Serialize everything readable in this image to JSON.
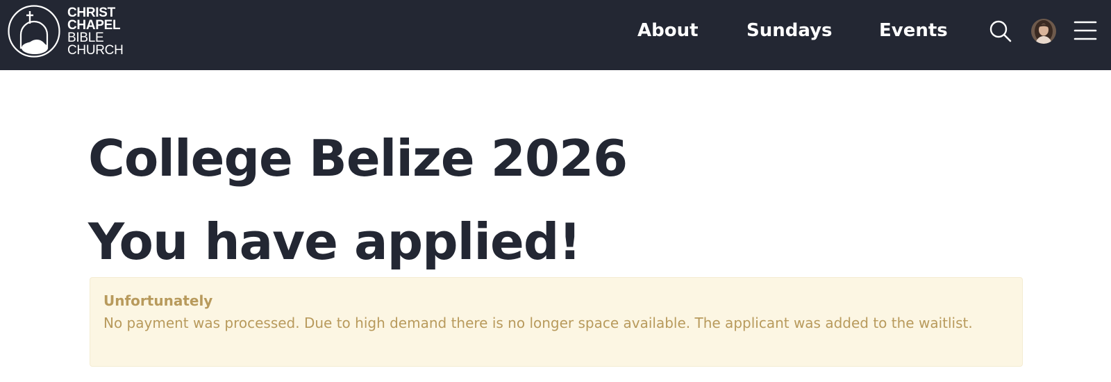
{
  "header": {
    "logo": {
      "lines": [
        "CHRIST",
        "CHAPEL",
        "BIBLE",
        "CHURCH"
      ]
    },
    "nav": [
      {
        "label": "About"
      },
      {
        "label": "Sundays"
      },
      {
        "label": "Events"
      }
    ],
    "icons": {
      "search": "search-icon",
      "avatar": "avatar",
      "menu": "hamburger-menu-icon"
    }
  },
  "main": {
    "event_title": "College Belize 2026",
    "heading": "You have applied!",
    "alert": {
      "title": "Unfortunately",
      "message": "No payment was processed. Due to high demand there is no longer space available. The applicant was added to the waitlist."
    }
  },
  "colors": {
    "header_bg": "#232733",
    "heading_text": "#232733",
    "alert_bg": "#fcf6e3",
    "alert_text": "#b89a5c"
  }
}
